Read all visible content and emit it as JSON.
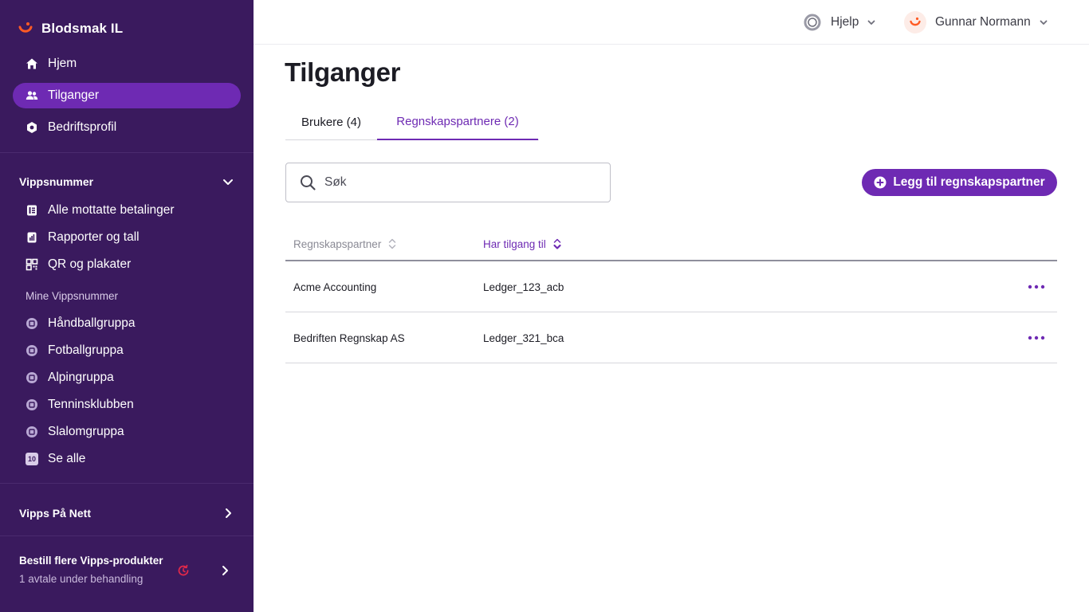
{
  "sidebar": {
    "brand": "Blodsmak IL",
    "main_nav": [
      {
        "label": "Hjem",
        "icon": "home-icon"
      },
      {
        "label": "Tilganger",
        "icon": "users-icon",
        "active": true
      },
      {
        "label": "Bedriftsprofil",
        "icon": "gear-icon"
      }
    ],
    "vippsnummer": {
      "title": "Vippsnummer",
      "items": [
        {
          "label": "Alle mottatte betalinger",
          "icon": "payments-icon"
        },
        {
          "label": "Rapporter og tall",
          "icon": "report-icon"
        },
        {
          "label": "QR og plakater",
          "icon": "qr-icon"
        }
      ],
      "mine_title": "Mine Vippsnummer",
      "mine_items": [
        {
          "label": "Håndballgruppa",
          "icon": "store-icon"
        },
        {
          "label": "Fotballgruppa",
          "icon": "store-icon"
        },
        {
          "label": "Alpingruppa",
          "icon": "store-icon"
        },
        {
          "label": "Tenninsklubben",
          "icon": "store-icon"
        },
        {
          "label": "Slalomgruppa",
          "icon": "store-icon"
        },
        {
          "label": "Se alle",
          "icon": "count-badge-icon",
          "badge": "10"
        }
      ]
    },
    "vipps_pa_nett": "Vipps På Nett",
    "bestill": {
      "title": "Bestill flere Vipps-produkter",
      "subtitle": "1 avtale under behandling"
    }
  },
  "header": {
    "help_label": "Hjelp",
    "user_name": "Gunnar Normann"
  },
  "main": {
    "title": "Tilganger",
    "tabs": [
      {
        "label": "Brukere (4)",
        "active": false
      },
      {
        "label": "Regnskapspartnere (2)",
        "active": true
      }
    ],
    "search": {
      "placeholder": "Søk",
      "value": ""
    },
    "add_button": "Legg til regnskapspartner",
    "table": {
      "columns": [
        "Regnskapspartner",
        "Har tilgang til"
      ],
      "rows": [
        {
          "partner": "Acme Accounting",
          "access": "Ledger_123_acb"
        },
        {
          "partner": "Bedriften Regnskap AS",
          "access": "Ledger_321_bca"
        }
      ]
    }
  },
  "colors": {
    "sidebar_bg": "#3a1a5e",
    "accent": "#6e2ab3",
    "brand_orange": "#ff5b24"
  }
}
